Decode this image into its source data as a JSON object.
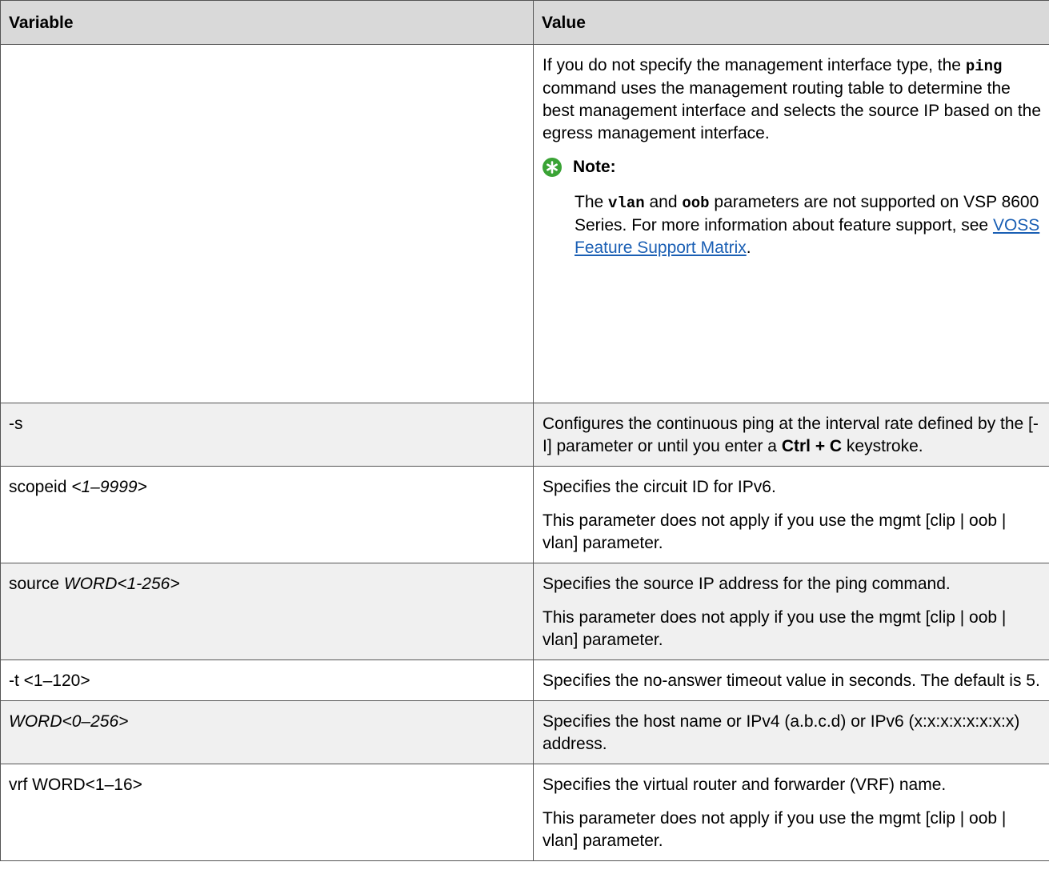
{
  "headers": {
    "variable": "Variable",
    "value": "Value"
  },
  "row1": {
    "value_p1_a": "If you do not specify the management interface type, the ",
    "value_p1_cmd": "ping",
    "value_p1_b": " command uses the management routing table to determine the best management interface and selects the source IP based on the egress management interface.",
    "note_label": "Note:",
    "note_a": "The ",
    "note_vlan": "vlan",
    "note_and": " and ",
    "note_oob": "oob",
    "note_b": " parameters are not supported on VSP 8600 Series. For more information about feature support, see ",
    "note_link": "VOSS Feature Support Matrix",
    "note_end": "."
  },
  "row2": {
    "variable": "-s",
    "value_a": "Configures the continuous ping at the interval rate defined by the [-I] parameter or until you enter a ",
    "value_bold": "Ctrl + C",
    "value_b": " keystroke."
  },
  "row3": {
    "variable_a": "scopeid ",
    "variable_it": "<1–9999>",
    "value_p1": "Specifies the circuit ID for IPv6.",
    "value_p2": "This parameter does not apply if you use the mgmt [clip | oob | vlan] parameter."
  },
  "row4": {
    "variable_a": "source ",
    "variable_it": "WORD<1-256>",
    "value_p1": "Specifies the source IP address for the ping command.",
    "value_p2": "This parameter does not apply if you use the mgmt [clip | oob | vlan] parameter."
  },
  "row5": {
    "variable": "-t <1–120>",
    "value": "Specifies the no-answer timeout value in seconds. The default is 5."
  },
  "row6": {
    "variable_it": "WORD<0–256>",
    "value": "Specifies the host name or IPv4 (a.b.c.d) or IPv6 (x:x:x:x:x:x:x:x) address."
  },
  "row7": {
    "variable": "vrf WORD<1–16>",
    "value_p1": "Specifies the virtual router and forwarder (VRF) name.",
    "value_p2": "This parameter does not apply if you use the mgmt [clip | oob | vlan] parameter."
  },
  "colors": {
    "header_bg": "#d9d9d9",
    "shade_bg": "#f0f0f0",
    "link": "#1a5fb4",
    "note_icon": "#3aa335"
  },
  "icons": {
    "note": "note-star-icon"
  }
}
